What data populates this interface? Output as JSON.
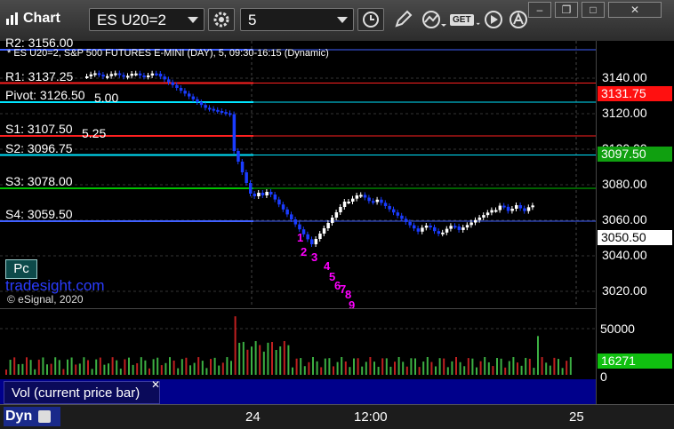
{
  "window": {
    "app_title": "Chart",
    "symbol": "ES U20=2",
    "interval": "5",
    "buttons": {
      "minimize": "–",
      "restore": "❐",
      "maximize": "□",
      "close": "✕"
    },
    "get_label": "GET"
  },
  "chart": {
    "header": "* ES U20=2, S&P 500 FUTURES E-MINI (DAY), 5, 09:30-16:15 (Dynamic)",
    "copyright": "© eSignal, 2020",
    "watermark": "tradesight.com",
    "pc_badge": "Pc",
    "levels": [
      {
        "label": "R2: 3156.00",
        "value": 3156.0,
        "color": "#4060ff"
      },
      {
        "label": "R1: 3137.25",
        "value": 3137.25,
        "color": "#ff2020"
      },
      {
        "label": "Pivot: 3126.50",
        "value": 3126.5,
        "color": "#00e5ff"
      },
      {
        "label": "S1: 3107.50",
        "value": 3107.5,
        "color": "#ff2020"
      },
      {
        "label": "S2: 3096.75",
        "value": 3096.75,
        "color": "#00e5ff"
      },
      {
        "label": "S3: 3078.00",
        "value": 3078.0,
        "color": "#00c000"
      },
      {
        "label": "S4: 3059.50",
        "value": 3059.5,
        "color": "#4060ff"
      }
    ],
    "overlap_fragments": [
      "5.00",
      "5.25"
    ],
    "count_labels": [
      "1",
      "2",
      "3",
      "4",
      "5",
      "6",
      "7",
      "8",
      "9"
    ],
    "price_ticks": [
      "3140.00",
      "3120.00",
      "3100.00",
      "3080.00",
      "3060.00",
      "3040.00",
      "3020.00"
    ],
    "price_tags": [
      {
        "text": "3131.75",
        "bg": "#ff1010",
        "fg": "#ffffff"
      },
      {
        "text": "3097.50",
        "bg": "#10a010",
        "fg": "#ffffff"
      },
      {
        "text": "3050.50",
        "bg": "#ffffff",
        "fg": "#000000"
      }
    ],
    "volume": {
      "label": "Vol (current price bar)",
      "ticks": [
        "50000",
        "0"
      ],
      "last_tag": "16271"
    },
    "time_ticks": [
      "24",
      "12:00",
      "25"
    ],
    "footer_label": "Dyn",
    "colors": {
      "up_bar": "#ffffff",
      "down_bar": "#1a3cff",
      "vol_up": "#3cb043",
      "vol_down": "#c02020",
      "count_magenta": "#ff00ff",
      "count_green": "#1f8f1f"
    }
  }
}
